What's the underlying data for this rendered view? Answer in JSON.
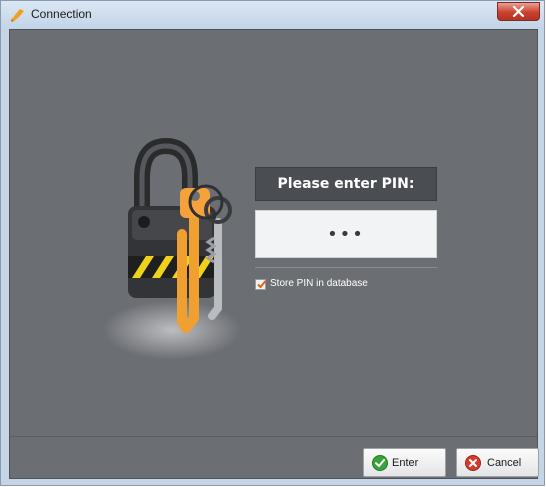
{
  "window": {
    "title": "Connection",
    "icons": {
      "app": "pen-icon",
      "close": "close-icon"
    }
  },
  "pin_prompt": {
    "heading": "Please enter PIN:",
    "value": "•••",
    "store_pin_label": "Store PIN in database",
    "store_pin_checked": true
  },
  "illustration": {
    "icon": "padlock-with-keys-icon"
  },
  "buttons": {
    "enter_label": "Enter",
    "cancel_label": "Cancel",
    "enter_icon": "check-icon",
    "cancel_icon": "cancel-icon"
  },
  "colors": {
    "client_bg": "#6b6e73",
    "heading_bg": "#4a4d52",
    "input_bg": "#f2f3f5",
    "accent_orange": "#f0a030",
    "enter_green": "#3aa33a",
    "cancel_red": "#d73b2e"
  }
}
